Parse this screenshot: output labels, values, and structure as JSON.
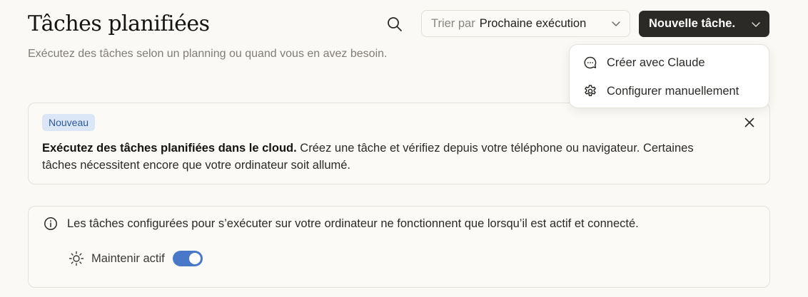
{
  "header": {
    "title": "Tâches planifiées",
    "subtitle": "Exécutez des tâches selon un planning ou quand vous en avez besoin."
  },
  "toolbar": {
    "search_icon": "search-icon",
    "sort_label": "Trier par",
    "sort_value": "Prochaine exécution",
    "new_task_label": "Nouvelle tâche."
  },
  "dropdown": {
    "items": [
      {
        "label": "Créer avec Claude",
        "icon": "chat-bubble-icon"
      },
      {
        "label": "Configurer manuellement",
        "icon": "gear-icon"
      }
    ]
  },
  "announcement": {
    "badge": "Nouveau",
    "bold_text": "Exécutez des tâches planifiées dans le cloud.",
    "text": " Créez une tâche et vérifiez depuis votre téléphone ou navigateur. Certaines tâches nécessitent encore que votre ordinateur soit allumé."
  },
  "info": {
    "message": "Les tâches configurées pour s’exécuter sur votre ordinateur ne fonctionnent que lorsqu’il est actif et connecté.",
    "keep_active_label": "Maintenir actif",
    "keep_active_on": true
  },
  "colors": {
    "background": "#faf9f5",
    "primary_button": "#2b2a27",
    "badge_bg": "#dbe6f6",
    "badge_text": "#2d5a9b",
    "toggle_on": "#4a78c8"
  }
}
